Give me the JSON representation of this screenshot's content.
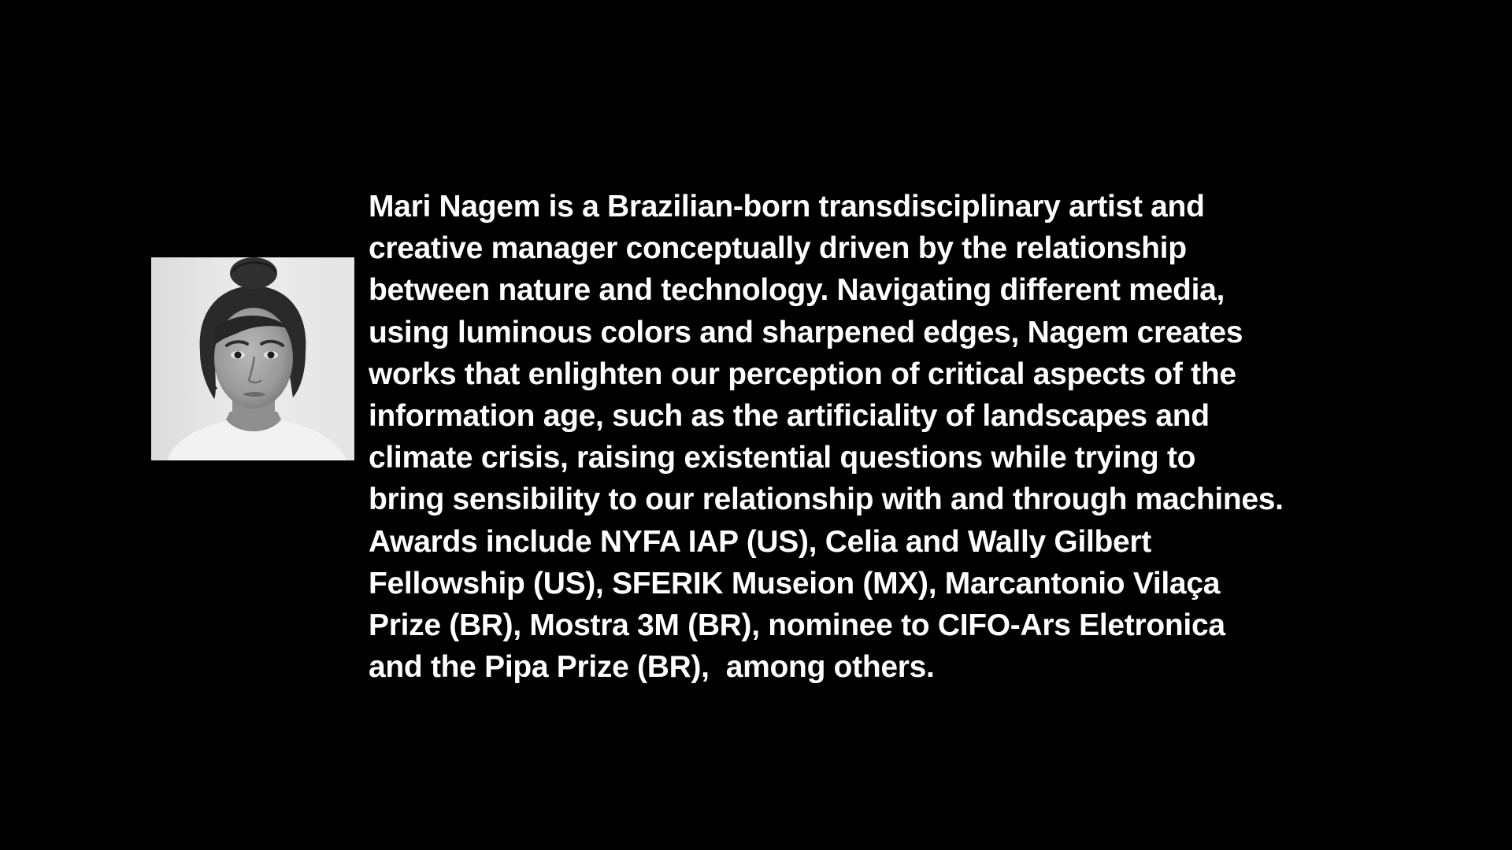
{
  "slide": {
    "background_color": "#000000",
    "text_color": "#ffffff",
    "portrait": {
      "subject": "Mari Nagem",
      "style": "black-and-white headshot"
    },
    "bio_lines": [
      "Mari Nagem is a Brazilian-born transdisciplinary artist and",
      "creative manager conceptually driven by the relationship",
      "between nature and technology. Navigating different media,",
      "using luminous colors and sharpened edges, Nagem creates",
      "works that enlighten our perception of critical aspects of the",
      "information age, such as the artificiality of landscapes and",
      "climate crisis, raising existential questions while trying to",
      "bring sensibility to our relationship with and through machines.",
      "Awards include NYFA IAP (US), Celia and Wally Gilbert",
      "Fellowship (US), SFERIK Museion (MX), Marcantonio Vilaça",
      "Prize (BR), Mostra 3M (BR), nominee to CIFO-Ars Eletronica",
      "and the Pipa Prize (BR),  among others."
    ]
  }
}
